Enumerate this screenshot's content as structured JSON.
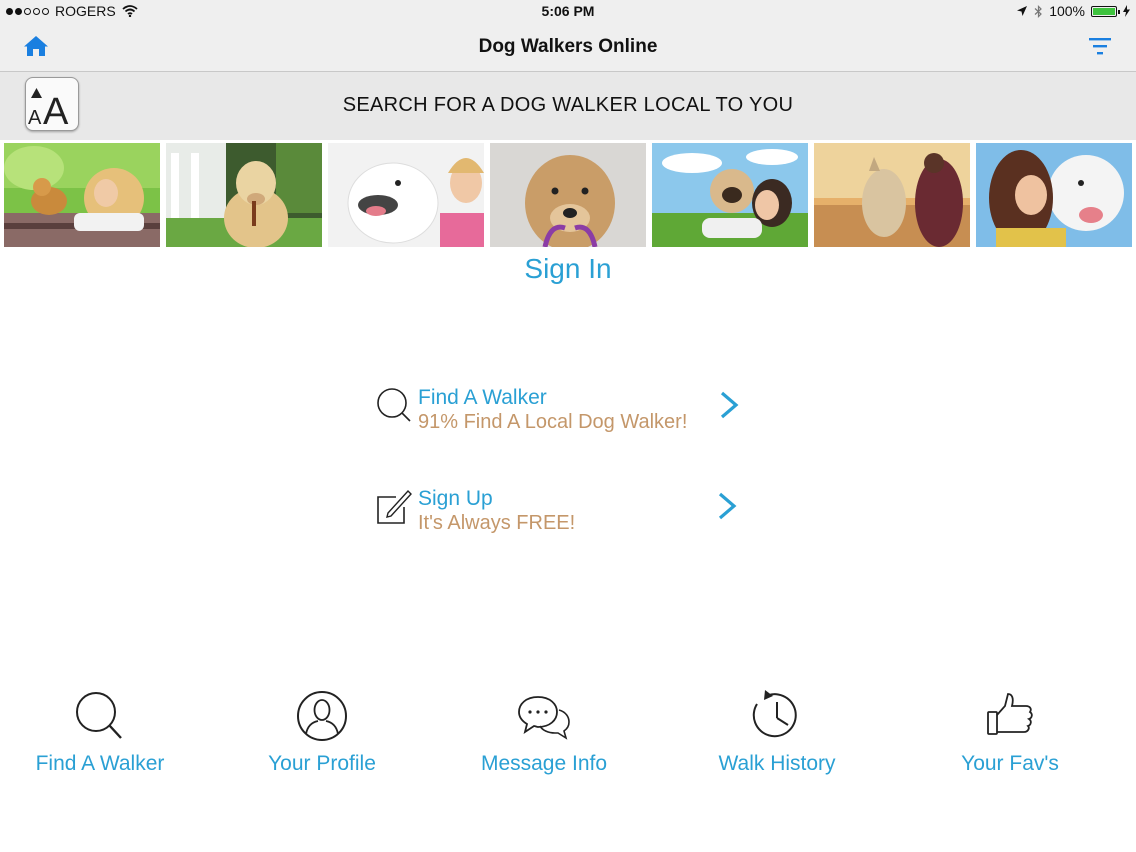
{
  "status_bar": {
    "carrier": "ROGERS",
    "time": "5:06 PM",
    "battery": "100%",
    "battery_level": 1.0,
    "battery_color": "#3ec33e"
  },
  "nav": {
    "title": "Dog Walkers Online",
    "home_icon": "home-icon",
    "filter_icon": "filter-icon",
    "accent": "#1a7fe0"
  },
  "search": {
    "title": "SEARCH FOR A DOG WALKER LOCAL TO YOU",
    "text_size_icon": "text-size-icon"
  },
  "photos": [
    {
      "name": "photo-girl-with-shiba"
    },
    {
      "name": "photo-labrador"
    },
    {
      "name": "photo-husky-with-woman"
    },
    {
      "name": "photo-terrier-with-leash"
    },
    {
      "name": "photo-pug-with-woman"
    },
    {
      "name": "photo-dog-at-sunset"
    },
    {
      "name": "photo-bulldog-kiss"
    }
  ],
  "signin_label": "Sign In",
  "menu": [
    {
      "title": "Find A Walker",
      "subtitle": "91% Find A Local Dog Walker!",
      "icon": "search-icon"
    },
    {
      "title": "Sign Up",
      "subtitle": "It's Always FREE!",
      "icon": "edit-icon"
    }
  ],
  "tabs": [
    {
      "label": "Find A Walker",
      "icon": "search-icon"
    },
    {
      "label": "Your Profile",
      "icon": "profile-icon"
    },
    {
      "label": "Message Info",
      "icon": "chat-icon"
    },
    {
      "label": "Walk History",
      "icon": "history-icon"
    },
    {
      "label": "Your Fav's",
      "icon": "thumbs-up-icon"
    }
  ],
  "colors": {
    "link_blue": "#2aa0d4",
    "subtitle_tan": "#c4976a"
  }
}
